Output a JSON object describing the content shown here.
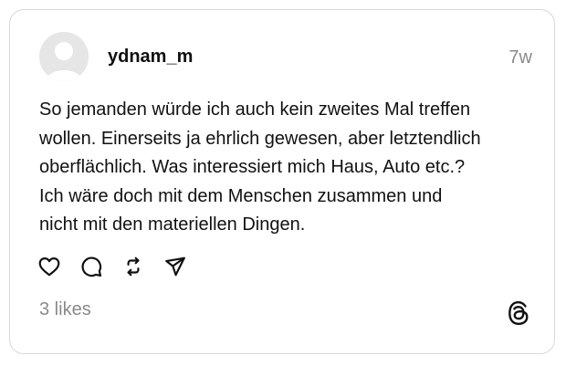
{
  "post": {
    "username": "ydnam_m",
    "timestamp": "7w",
    "text": "So jemanden würde ich auch kein zweites Mal treffen\nwollen. Einerseits ja ehrlich gewesen, aber letztendlich\noberflächlich. Was interessiert mich Haus, Auto etc.?\nIch wäre doch mit dem Menschen zusammen und\nnicht mit den materiellen Dingen.",
    "likes": "3 likes"
  },
  "actions": {
    "icons": [
      "heart-icon",
      "comment-icon",
      "repost-icon",
      "share-icon"
    ]
  },
  "brand": {
    "icon": "threads-logo-icon"
  },
  "colors": {
    "text": "#101010",
    "muted": "#8a8a8a",
    "border": "#d8d8d8",
    "avatar_bg": "#e6e6e6"
  }
}
